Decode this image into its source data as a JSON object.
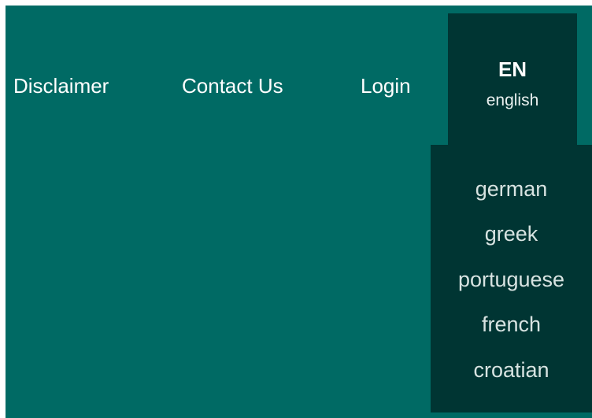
{
  "nav": {
    "disclaimer": "Disclaimer",
    "contact": "Contact Us",
    "login": "Login"
  },
  "language": {
    "current_code": "EN",
    "current_name": "english",
    "options": [
      "german",
      "greek",
      "portuguese",
      "french",
      "croatian"
    ]
  },
  "colors": {
    "background": "#006a64",
    "dropdown": "#003533",
    "text": "#ffffff"
  }
}
